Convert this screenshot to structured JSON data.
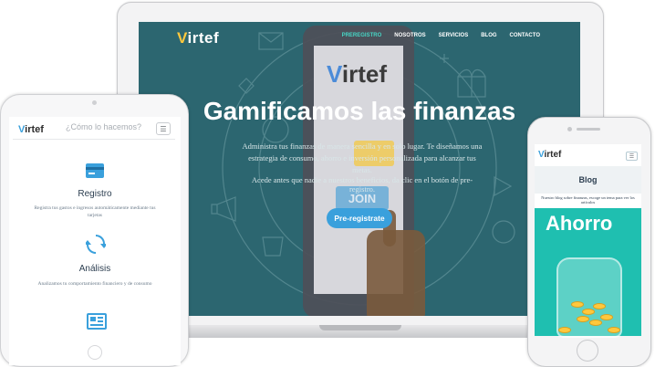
{
  "laptop": {
    "logo": "irtef",
    "nav": [
      "PREREGISTRO",
      "NOSOTROS",
      "SERVICIOS",
      "BLOG",
      "CONTACTO"
    ],
    "hero_title": "Gamificamos las finanzas",
    "hero_text": "Administra tus finanzas de manera sencilla y en solo lugar. Te diseñamos una estrategia de consumo, ahorro e inversión personalizada para alcanzar tus metas.",
    "hero_text2": "Acede antes que nadie a nuestros beneficios, da clic en el botón de pre-registro.",
    "cta": "Pre-registrate",
    "art_logo": "irtef",
    "art_join": "JOIN"
  },
  "tablet": {
    "logo": "irtef",
    "search_text": "¿Cómo lo hacemos?",
    "menu_icon": "☰",
    "features": [
      {
        "icon": "card-icon",
        "title": "Registro",
        "desc": "Registra tus gastos e ingresos automáticamente mediante tus tarjetas"
      },
      {
        "icon": "refresh-icon",
        "title": "Análisis",
        "desc": "Analizamos tu comportamiento financiero y de consumo"
      },
      {
        "icon": "newspaper-icon",
        "title": "",
        "desc": ""
      }
    ]
  },
  "phone": {
    "logo": "irtef",
    "menu_icon": "☰",
    "blog_title": "Blog",
    "blog_subtitle": "Nuestro blog sobre finanzas, escoge un tema para ver los artículos",
    "card_title": "Ahorro"
  },
  "colors": {
    "hero_bg": "#2c6670",
    "accent_blue": "#3aa0dc",
    "nav_active": "#47d6c6",
    "card_teal": "#1fbfb0",
    "coin_gold": "#ffc83d"
  }
}
